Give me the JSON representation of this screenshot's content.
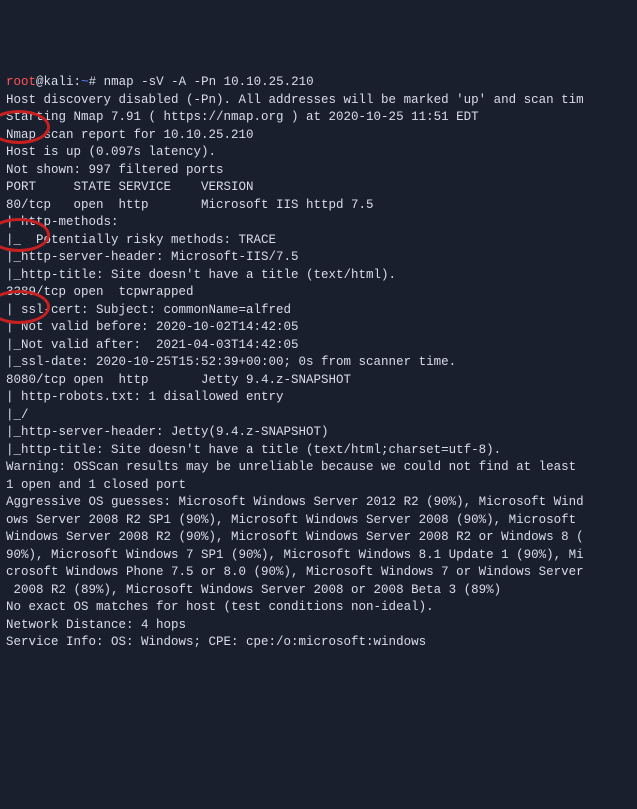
{
  "prompt": {
    "user": "root",
    "host": "kali",
    "path": "~",
    "cmd": "nmap -sV -A -Pn 10.10.25.210"
  },
  "lines": [
    "Host discovery disabled (-Pn). All addresses will be marked 'up' and scan tim",
    "Starting Nmap 7.91 ( https://nmap.org ) at 2020-10-25 11:51 EDT",
    "Nmap scan report for 10.10.25.210",
    "Host is up (0.097s latency).",
    "Not shown: 997 filtered ports",
    "PORT     STATE SERVICE    VERSION",
    "80/tcp   open  http       Microsoft IIS httpd 7.5",
    "| http-methods:",
    "|_  Potentially risky methods: TRACE",
    "|_http-server-header: Microsoft-IIS/7.5",
    "|_http-title: Site doesn't have a title (text/html).",
    "3389/tcp open  tcpwrapped",
    "| ssl-cert: Subject: commonName=alfred",
    "| Not valid before: 2020-10-02T14:42:05",
    "|_Not valid after:  2021-04-03T14:42:05",
    "|_ssl-date: 2020-10-25T15:52:39+00:00; 0s from scanner time.",
    "8080/tcp open  http       Jetty 9.4.z-SNAPSHOT",
    "| http-robots.txt: 1 disallowed entry",
    "|_/",
    "|_http-server-header: Jetty(9.4.z-SNAPSHOT)",
    "|_http-title: Site doesn't have a title (text/html;charset=utf-8).",
    "Warning: OSScan results may be unreliable because we could not find at least ",
    "1 open and 1 closed port",
    "Aggressive OS guesses: Microsoft Windows Server 2012 R2 (90%), Microsoft Wind",
    "ows Server 2008 R2 SP1 (90%), Microsoft Windows Server 2008 (90%), Microsoft ",
    "Windows Server 2008 R2 (90%), Microsoft Windows Server 2008 R2 or Windows 8 (",
    "90%), Microsoft Windows 7 SP1 (90%), Microsoft Windows 8.1 Update 1 (90%), Mi",
    "crosoft Windows Phone 7.5 or 8.0 (90%), Microsoft Windows 7 or Windows Server",
    " 2008 R2 (89%), Microsoft Windows Server 2008 or 2008 Beta 3 (89%)",
    "No exact OS matches for host (test conditions non-ideal).",
    "Network Distance: 4 hops",
    "Service Info: OS: Windows; CPE: cpe:/o:microsoft:windows"
  ]
}
